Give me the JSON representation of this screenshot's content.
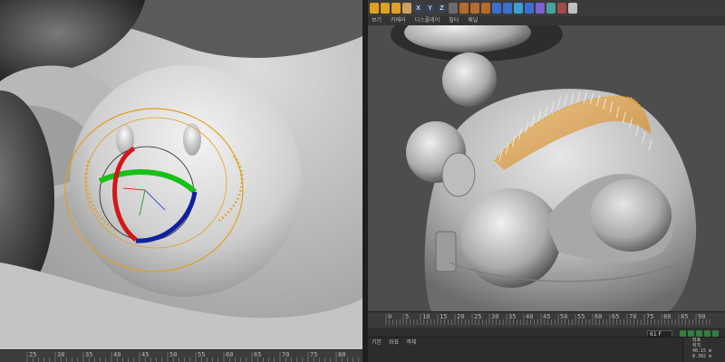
{
  "left_viewport": {
    "ruler_ticks": [
      "25",
      "30",
      "35",
      "40",
      "45",
      "50",
      "55",
      "60",
      "65",
      "70",
      "75",
      "80"
    ]
  },
  "right_viewport": {
    "toolbar_icons": [
      "move-icon",
      "scale-icon",
      "rotate-icon",
      "select-icon",
      "x-axis-icon",
      "y-axis-icon",
      "z-axis-icon",
      "world-icon",
      "render-region-icon",
      "render-view-icon",
      "render-settings-icon",
      "cube-icon",
      "spline-icon",
      "nurbs-icon",
      "array-icon",
      "deformer-icon",
      "scene-icon",
      "camera-icon",
      "light-icon"
    ],
    "axis_labels": {
      "x": "X",
      "y": "Y",
      "z": "Z"
    },
    "menu_items": [
      "보기",
      "카메라",
      "디스플레이",
      "필터",
      "패널"
    ],
    "timeline_ticks": [
      "0",
      "5",
      "10",
      "15",
      "20",
      "25",
      "30",
      "35",
      "40",
      "45",
      "50",
      "55",
      "60",
      "65",
      "70",
      "75",
      "80",
      "85",
      "90"
    ],
    "current_frame": "61 F",
    "bottom_tabs": [
      "기본",
      "좌표",
      "객체"
    ],
    "attributes": {
      "header": "좌표",
      "section": "위치",
      "pos_x": "40.15 m",
      "pos_y": "8.302 m",
      "pos_z": "-10.288 m"
    }
  },
  "colors": {
    "gizmo_x": "#d01818",
    "gizmo_y": "#18c018",
    "gizmo_z": "#1020a0",
    "selection": "#e0a020",
    "hair_sheet": "#d9a35c",
    "play_button": "#2f7f3f"
  }
}
